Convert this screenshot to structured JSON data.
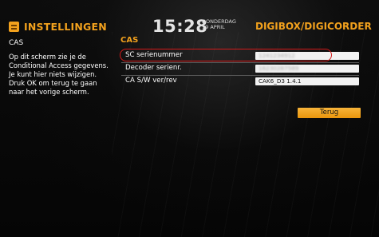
{
  "header": {
    "section_title": "INSTELLINGEN",
    "time": "15:28",
    "day": "DONDERDAG",
    "date": "19 APRIL",
    "brand": "DIGIBOX/DIGICORDER"
  },
  "left_panel": {
    "title": "CAS",
    "description": "Op dit scherm zie je de Conditional Access gegevens. Je kunt hier niets wijzigen. Druk OK om terug te gaan naar het vorige scherm."
  },
  "cas": {
    "title": "CAS",
    "rows": [
      {
        "label": "SC serienummer",
        "value": "1241234912"
      },
      {
        "label": "Decoder serienr.",
        "value": "16230287589"
      },
      {
        "label": "CA S/W ver/rev",
        "value": "CAK6_D3 1.4.1"
      }
    ]
  },
  "buttons": {
    "back_label": "Terug"
  },
  "colors": {
    "accent": "#f2a11d",
    "highlight": "#d41a1a",
    "background": "#070707"
  }
}
